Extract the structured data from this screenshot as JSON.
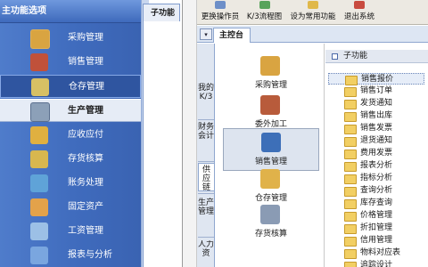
{
  "left_menu": {
    "title": "主功能选项",
    "items": [
      {
        "label": "采购管理",
        "icon": "purchase-icon"
      },
      {
        "label": "销售管理",
        "icon": "sales-icon"
      },
      {
        "label": "仓存管理",
        "icon": "warehouse-icon"
      },
      {
        "label": "生产管理",
        "icon": "production-icon"
      },
      {
        "label": "应收应付",
        "icon": "receivable-icon"
      },
      {
        "label": "存货核算",
        "icon": "inventory-icon"
      },
      {
        "label": "账务处理",
        "icon": "accounting-icon"
      },
      {
        "label": "固定资产",
        "icon": "fixed-assets-icon"
      },
      {
        "label": "工资管理",
        "icon": "payroll-icon"
      },
      {
        "label": "报表与分析",
        "icon": "report-icon"
      }
    ]
  },
  "left_subtab": "子功能",
  "toolbar": {
    "items": [
      {
        "label": "更换操作员",
        "icon": "user-switch-icon"
      },
      {
        "label": "K/3流程图",
        "icon": "flowchart-icon"
      },
      {
        "label": "设为常用功能",
        "icon": "favorite-icon"
      },
      {
        "label": "退出系统",
        "icon": "exit-icon"
      }
    ]
  },
  "main_tab": {
    "label": "主控台",
    "menu_glyph": "▾"
  },
  "vertical_tabs": [
    {
      "label": "我的K/3"
    },
    {
      "label": "财务会计"
    },
    {
      "label": "供应链"
    },
    {
      "label": "生产管理"
    },
    {
      "label": "人力资"
    }
  ],
  "center_items": [
    {
      "label": "采购管理",
      "icon": "purchase-icon"
    },
    {
      "label": "委外加工",
      "icon": "outsourcing-icon"
    },
    {
      "label": "销售管理",
      "icon": "sales-truck-icon"
    },
    {
      "label": "仓存管理",
      "icon": "warehouse-house-icon"
    },
    {
      "label": "存货核算",
      "icon": "inventory-calc-icon"
    }
  ],
  "sub_functions": {
    "title": "子功能",
    "items": [
      "销售报价",
      "销售订单",
      "发货通知",
      "销售出库",
      "销售发票",
      "退货通知",
      "费用发票",
      "报表分析",
      "指标分析",
      "查询分析",
      "库存查询",
      "价格管理",
      "折扣管理",
      "信用管理",
      "物料对应表",
      "追踪设计"
    ]
  },
  "colors": {
    "left_bg": "#3f6bbd",
    "header_bg": "#4f7ccb",
    "folder": "#f2cf63",
    "toolbar_bg": "#ece9e2"
  }
}
